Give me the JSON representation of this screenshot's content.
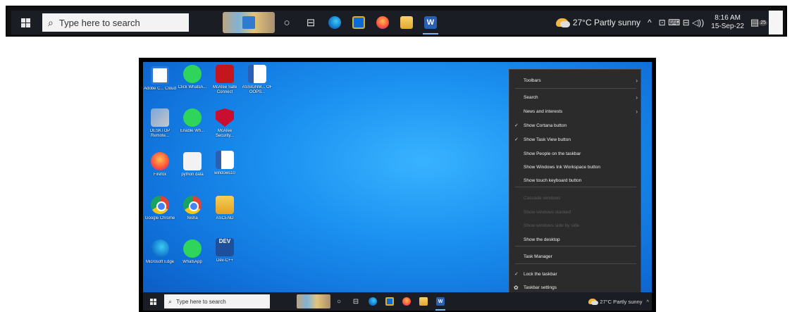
{
  "top_taskbar": {
    "search_placeholder": "Type here to search",
    "cortana_icon": "○",
    "taskview_icon": "⊟",
    "pinned": [
      "edge-icon",
      "store-icon",
      "firefox-icon",
      "file-explorer-icon",
      "word-icon"
    ],
    "word_glyph": "W",
    "weather": "27°C  Partly sunny",
    "tray_chevron": "^",
    "tray_icons": "⊡  ⌨  ⊟  ◁))",
    "time": "8:16 AM",
    "date": "15-Sep-22",
    "notification_badge": "25"
  },
  "desktop": {
    "icons": [
      {
        "label": "Adobe C... Cloud"
      },
      {
        "label": "Click WhatsA..."
      },
      {
        "label": "McAfee Safe Connect"
      },
      {
        "label": "ASSIGNM... OF OOPS..."
      },
      {
        "label": "DESKTOP Remote..."
      },
      {
        "label": "Enable Wh..."
      },
      {
        "label": "McAfee Security..."
      },
      {
        "label": "Firefox"
      },
      {
        "label": "python data"
      },
      {
        "label": "windows10"
      },
      {
        "label": "Google Chrome"
      },
      {
        "label": "Nisha"
      },
      {
        "label": "ASCEND"
      },
      {
        "label": "Microsoft Edge"
      },
      {
        "label": "WhatsApp"
      },
      {
        "label": "Dev-C++"
      }
    ],
    "dev_glyph": "DEV"
  },
  "context_menu": {
    "items": [
      {
        "label": "Toolbars",
        "submenu": true,
        "checked": false,
        "disabled": false
      },
      {
        "label": "Search",
        "submenu": true,
        "checked": false,
        "disabled": false
      },
      {
        "label": "News and interests",
        "submenu": true,
        "checked": false,
        "disabled": false
      },
      {
        "label": "Show Cortana button",
        "submenu": false,
        "checked": true,
        "disabled": false
      },
      {
        "label": "Show Task View button",
        "submenu": false,
        "checked": true,
        "disabled": false
      },
      {
        "label": "Show People on the taskbar",
        "submenu": false,
        "checked": false,
        "disabled": false
      },
      {
        "label": "Show Windows Ink Workspace button",
        "submenu": false,
        "checked": false,
        "disabled": false
      },
      {
        "label": "Show touch keyboard button",
        "submenu": false,
        "checked": false,
        "disabled": false
      },
      {
        "label": "Cascade windows",
        "submenu": false,
        "checked": false,
        "disabled": true
      },
      {
        "label": "Show windows stacked",
        "submenu": false,
        "checked": false,
        "disabled": true
      },
      {
        "label": "Show windows side by side",
        "submenu": false,
        "checked": false,
        "disabled": true
      },
      {
        "label": "Show the desktop",
        "submenu": false,
        "checked": false,
        "disabled": false
      },
      {
        "label": "Task Manager",
        "submenu": false,
        "checked": false,
        "disabled": false
      },
      {
        "label": "Lock the taskbar",
        "submenu": false,
        "checked": true,
        "disabled": false
      },
      {
        "label": "Taskbar settings",
        "submenu": false,
        "checked": false,
        "disabled": false
      }
    ],
    "check_glyph": "✓",
    "arrow_glyph": "›",
    "gear_glyph": "✿"
  },
  "inner_taskbar": {
    "search_placeholder": "Type here to search",
    "weather": "27°C  Partly sunny",
    "tray_chevron": "^"
  }
}
